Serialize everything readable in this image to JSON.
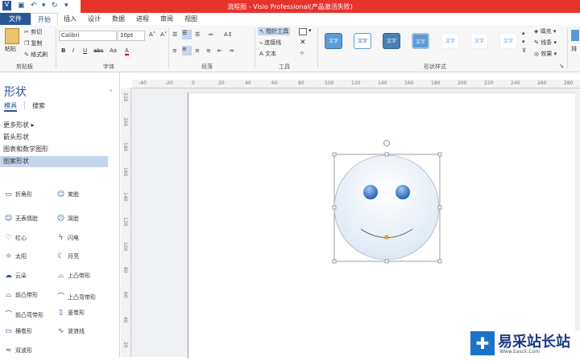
{
  "window": {
    "title": "流程图 - Visio Professional(产品激活失败)"
  },
  "qat": {
    "icons": [
      "visio-logo-icon",
      "save-icon",
      "undo-icon",
      "redo-icon",
      "customize-icon"
    ]
  },
  "tabs": [
    "文件",
    "开始",
    "插入",
    "设计",
    "数据",
    "进程",
    "审阅",
    "视图"
  ],
  "ribbon": {
    "clipboard": {
      "paste": "粘贴",
      "cut": "剪切",
      "copy": "复制",
      "format_painter": "格式刷",
      "label": "剪贴板"
    },
    "font": {
      "name": "Calibri",
      "size": "10pt",
      "label": "字体",
      "bold": "B",
      "italic": "I",
      "underline": "U",
      "strike": "abc",
      "case": "Aa",
      "color": "A"
    },
    "paragraph": {
      "label": "段落"
    },
    "tools": {
      "pointer": "指针工具",
      "connector": "连接线",
      "text": "文本",
      "label": "工具"
    },
    "shape_styles": {
      "swatch_text": "文字",
      "label": "形状样式",
      "fill": "填充",
      "line": "线条",
      "effect": "效果",
      "arrange": "排"
    }
  },
  "shapes_pane": {
    "title": "形状",
    "tabs": [
      "模具",
      "搜索"
    ],
    "more_shapes": "更多形状",
    "stencils": [
      "箭头形状",
      "图表和数学图形",
      "图案形状"
    ],
    "items": [
      {
        "label": "折角形",
        "icon": "folded-corner-icon"
      },
      {
        "label": "笑脸",
        "icon": "smiley-icon"
      },
      {
        "label": "无表情脸",
        "icon": "neutral-face-icon"
      },
      {
        "label": "哭脸",
        "icon": "sad-face-icon"
      },
      {
        "label": "红心",
        "icon": "heart-icon"
      },
      {
        "label": "闪电",
        "icon": "lightning-icon"
      },
      {
        "label": "太阳",
        "icon": "sun-icon"
      },
      {
        "label": "月亮",
        "icon": "moon-icon"
      },
      {
        "label": "云朵",
        "icon": "cloud-icon"
      },
      {
        "label": "上凸带形",
        "icon": "ribbon-up-icon"
      },
      {
        "label": "前凸带形",
        "icon": "ribbon-front-icon"
      },
      {
        "label": "上凸弯带形",
        "icon": "curved-ribbon-up-icon"
      },
      {
        "label": "前凸弯带形",
        "icon": "curved-ribbon-front-icon"
      },
      {
        "label": "竖卷形",
        "icon": "vertical-scroll-icon"
      },
      {
        "label": "横卷形",
        "icon": "horizontal-scroll-icon"
      },
      {
        "label": "波浪线",
        "icon": "wave-icon"
      },
      {
        "label": "双波形",
        "icon": "double-wave-icon"
      }
    ]
  },
  "ruler": {
    "top": [
      "-40",
      "-20",
      "0",
      "20",
      "40",
      "60",
      "80",
      "100",
      "120",
      "140",
      "160",
      "180",
      "200",
      "220",
      "240",
      "260",
      "280"
    ],
    "left": [
      "220",
      "200",
      "180",
      "160",
      "140",
      "120",
      "100",
      "80",
      "60",
      "40",
      "20"
    ]
  },
  "canvas": {
    "shape": "smiley-face"
  },
  "watermark": {
    "text": "易采站长站",
    "sub": "Www.Easck.Com"
  }
}
